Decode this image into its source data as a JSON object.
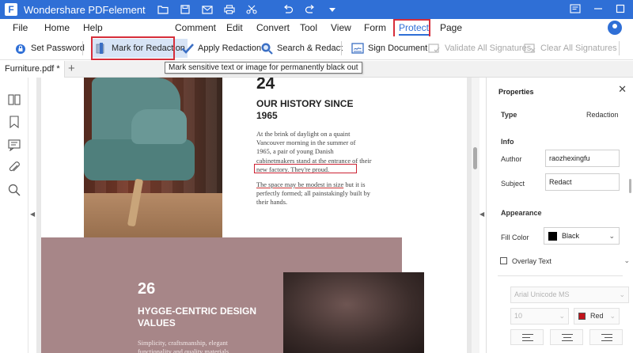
{
  "app": {
    "title": "Wondershare PDFelement",
    "logo_glyph": "F",
    "accent_color": "#2f6fd6",
    "highlight_color": "#d62e3a"
  },
  "menu": {
    "items": [
      "File",
      "Home",
      "Help",
      "Comment",
      "Edit",
      "Convert",
      "Tool",
      "View",
      "Form",
      "Protect",
      "Page"
    ],
    "active": "Protect"
  },
  "ribbon": {
    "set_password": "Set Password",
    "mark_for_redaction": "Mark for Redaction",
    "apply_redaction": "Apply Redaction",
    "search_redact": "Search & Redact",
    "sign_document": "Sign Document",
    "validate_all": "Validate All Signatures",
    "clear_all": "Clear All Signatures"
  },
  "tooltip": "Mark sensitive text or image for permanently black out",
  "tabs": {
    "document_tab": "Furniture.pdf *",
    "add_tab": "+"
  },
  "document": {
    "number_1": "24",
    "heading_1": "OUR HISTORY SINCE 1965",
    "para_1": "At the brink of daylight on a quaint Vancouver morning in the summer of 1965, a pair of young Danish cabinetmakers stand at the entrance of their new factory. They're proud.",
    "para_2_underlined": "The space may be modest in size",
    "para_2_rest": " but it is perfectly formed; all painstakingly built by their hands.",
    "number_2": "26",
    "heading_2": "HYGGE-CENTRIC DESIGN VALUES",
    "para_3": "Simplicity, craftsmanship, elegant functionality and quality materials"
  },
  "properties": {
    "title": "Properties",
    "type_label": "Type",
    "type_value": "Redaction",
    "info_label": "Info",
    "author_label": "Author",
    "author_value": "raozhexingfu",
    "subject_label": "Subject",
    "subject_value": "Redact",
    "appearance_label": "Appearance",
    "fill_color_label": "Fill Color",
    "fill_color_value": "Black",
    "overlay_text_label": "Overlay Text",
    "font_value": "Arial Unicode MS",
    "font_size_value": "10",
    "font_color_value": "Red"
  },
  "icons": {
    "set_password": "lock-icon",
    "mark_for_redaction": "redaction-marker-icon",
    "apply_redaction": "checkmark-icon",
    "search_redact": "magnifier-icon",
    "sign_document": "sign-document-icon",
    "validate_all": "validate-signature-icon",
    "clear_all": "clear-signature-icon",
    "rail": [
      "thumbnails-icon",
      "bookmark-icon",
      "comment-icon",
      "attachment-icon",
      "search-icon"
    ]
  }
}
